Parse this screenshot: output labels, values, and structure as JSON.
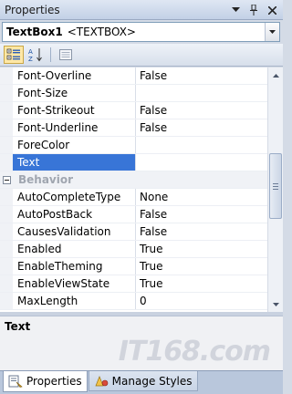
{
  "window": {
    "title": "Properties"
  },
  "selector": {
    "object_name": "TextBox1",
    "object_type": "<TEXTBOX>"
  },
  "toolbar": {
    "tools": [
      "categorized-icon",
      "alphabetical-icon",
      "property-pages-icon"
    ],
    "active_tool": "categorized-icon"
  },
  "grid": {
    "rows_top": [
      {
        "name": "Font-Overline",
        "value": "False"
      },
      {
        "name": "Font-Size",
        "value": ""
      },
      {
        "name": "Font-Strikeout",
        "value": "False"
      },
      {
        "name": "Font-Underline",
        "value": "False"
      },
      {
        "name": "ForeColor",
        "value": ""
      },
      {
        "name": "Text",
        "value": ""
      }
    ],
    "selected_row": "Text",
    "category": "Behavior",
    "rows_behavior": [
      {
        "name": "AutoCompleteType",
        "value": "None"
      },
      {
        "name": "AutoPostBack",
        "value": "False"
      },
      {
        "name": "CausesValidation",
        "value": "False"
      },
      {
        "name": "Enabled",
        "value": "True"
      },
      {
        "name": "EnableTheming",
        "value": "True"
      },
      {
        "name": "EnableViewState",
        "value": "True"
      },
      {
        "name": "MaxLength",
        "value": "0"
      }
    ]
  },
  "description": {
    "title": "Text"
  },
  "watermark": "IT168.com",
  "tabs": [
    {
      "label": "Properties",
      "active": true
    },
    {
      "label": "Manage Styles",
      "active": false
    }
  ],
  "colors": {
    "selection": "#3875d7",
    "category_text": "#a0a6b0"
  }
}
